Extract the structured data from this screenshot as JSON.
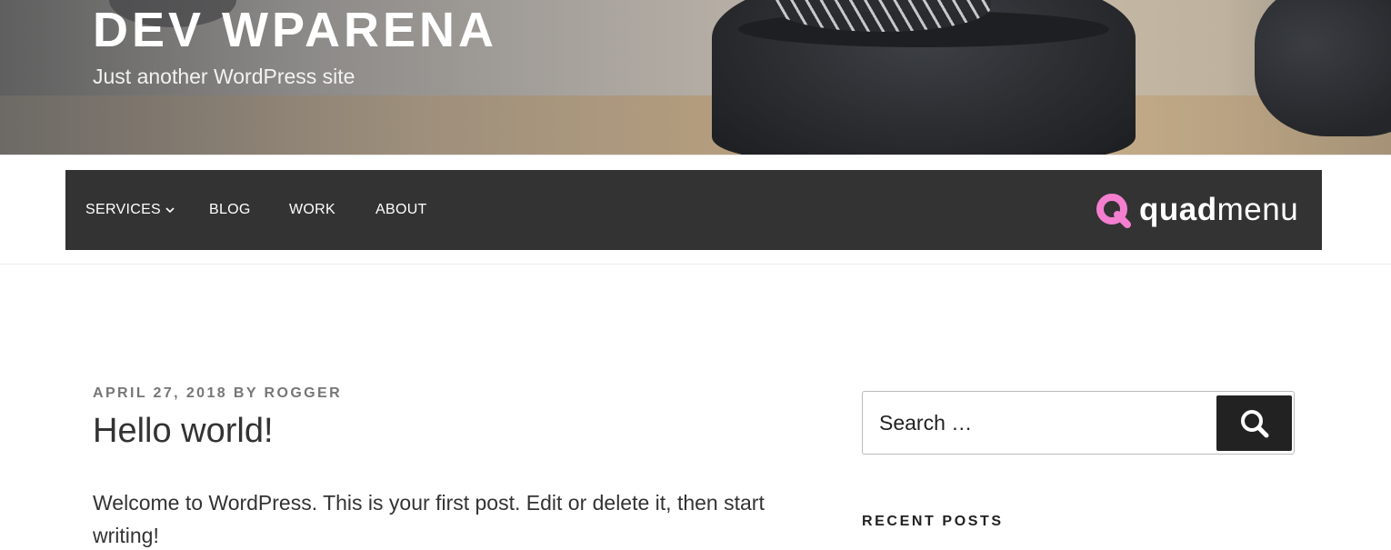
{
  "site": {
    "title": "DEV WPARENA",
    "tagline": "Just another WordPress site"
  },
  "nav": {
    "items": [
      {
        "label": "SERVICES",
        "has_dropdown": true
      },
      {
        "label": "BLOG"
      },
      {
        "label": "WORK"
      },
      {
        "label": "ABOUT"
      }
    ],
    "brand": {
      "bold": "quad",
      "regular": "menu",
      "accent_color": "#f47fd0"
    },
    "background": "#333333"
  },
  "post": {
    "date": "APRIL 27, 2018",
    "by": "BY",
    "author": "ROGGER",
    "title": "Hello world!",
    "content": "Welcome to WordPress. This is your first post. Edit or delete it, then start writing!"
  },
  "sidebar": {
    "search": {
      "placeholder": "Search …",
      "icon": "search-icon"
    },
    "recent_posts_title": "RECENT POSTS"
  }
}
